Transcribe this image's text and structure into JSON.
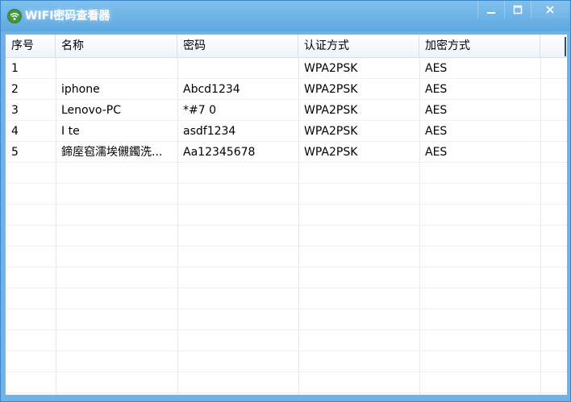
{
  "window": {
    "title": "WIFI密码查看器",
    "icon": "wifi-icon",
    "controls": {
      "minimize": "minimize-icon",
      "maximize": "maximize-icon",
      "close": "close-icon"
    }
  },
  "table": {
    "columns": [
      "序号",
      "名称",
      "密码",
      "认证方式",
      "加密方式"
    ],
    "rows": [
      [
        "1",
        "",
        "",
        "WPA2PSK",
        "AES"
      ],
      [
        "2",
        "iphone",
        "Abcd1234",
        "WPA2PSK",
        "AES"
      ],
      [
        "3",
        "Lenovo-PC",
        "*#7     0",
        "WPA2PSK",
        "AES"
      ],
      [
        "4",
        "I        te",
        "asdf1234",
        "WPA2PSK",
        "AES"
      ],
      [
        "5",
        "鍗庢窇濡埃儭鐲洗...",
        "Aa12345678",
        "WPA2PSK",
        "AES"
      ]
    ]
  },
  "colors": {
    "title_bar": "#6fb3e6",
    "border": "#3a86c8",
    "grid": "#e6ebf0"
  }
}
